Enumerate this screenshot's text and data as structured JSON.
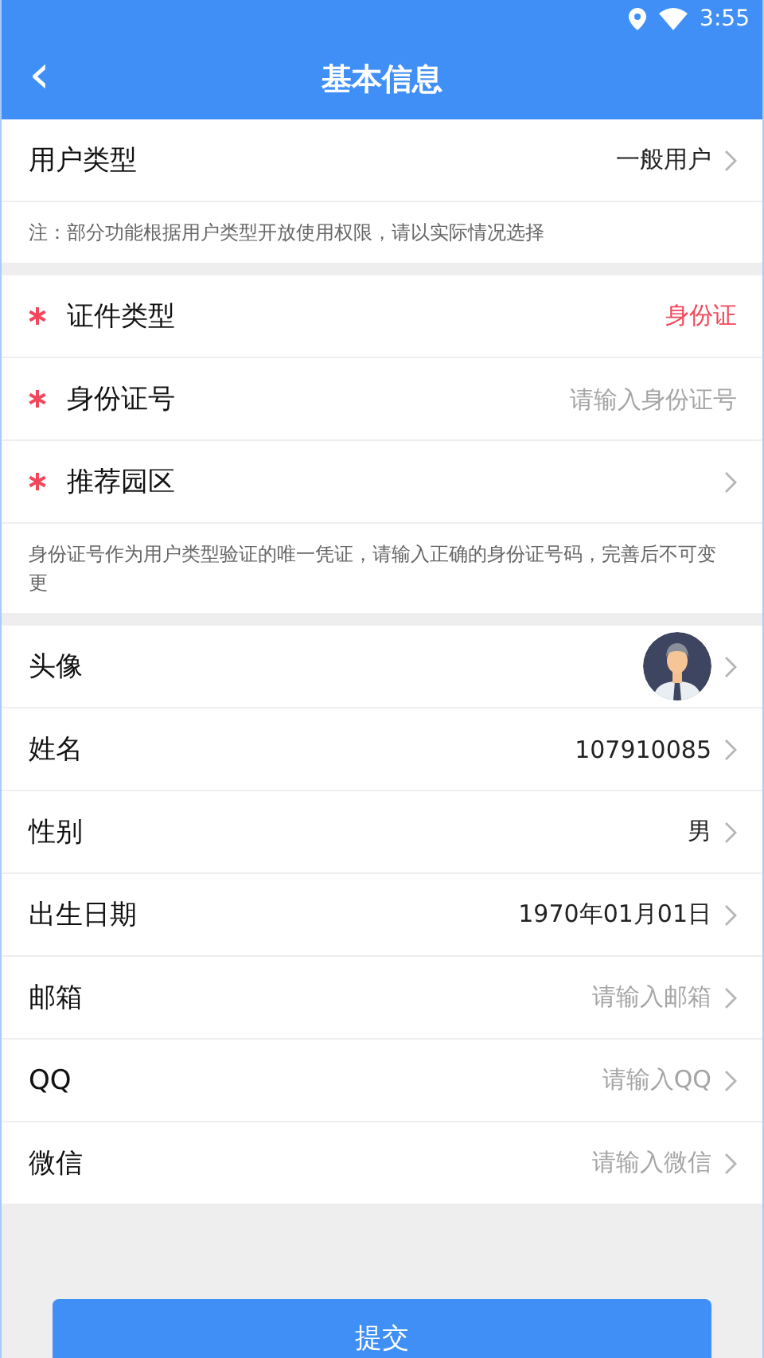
{
  "status_bar": {
    "time": "3:55"
  },
  "header": {
    "back": "‹",
    "title": "基本信息"
  },
  "sections": [
    {
      "rows": [
        {
          "kind": "select",
          "label": "用户类型",
          "required": false,
          "value": "一般用户"
        }
      ],
      "note": "注：部分功能根据用户类型开放使用权限，请以实际情况选择"
    },
    {
      "rows": [
        {
          "kind": "fixed",
          "label": "证件类型",
          "required": true,
          "value": "身份证"
        },
        {
          "kind": "input",
          "label": "身份证号",
          "required": true,
          "placeholder": "请输入身份证号"
        },
        {
          "kind": "select",
          "label": "推荐园区",
          "required": true
        }
      ],
      "note": "身份证号作为用户类型验证的唯一凭证，请输入正确的身份证号码，完善后不可变更"
    },
    {
      "rows": [
        {
          "kind": "avatar",
          "label": "头像",
          "required": false
        },
        {
          "kind": "select",
          "label": "姓名",
          "required": false,
          "value": "107910085"
        },
        {
          "kind": "select",
          "label": "性别",
          "required": false,
          "value": "男"
        },
        {
          "kind": "select",
          "label": "出生日期",
          "required": false,
          "value": "1970年01月01日"
        },
        {
          "kind": "select",
          "label": "邮箱",
          "required": false,
          "placeholder": "请输入邮箱"
        },
        {
          "kind": "select",
          "label": "QQ",
          "required": false,
          "placeholder": "请输入QQ"
        },
        {
          "kind": "select",
          "label": "微信",
          "required": false,
          "placeholder": "请输入微信"
        }
      ]
    }
  ],
  "submit_button": "提交"
}
